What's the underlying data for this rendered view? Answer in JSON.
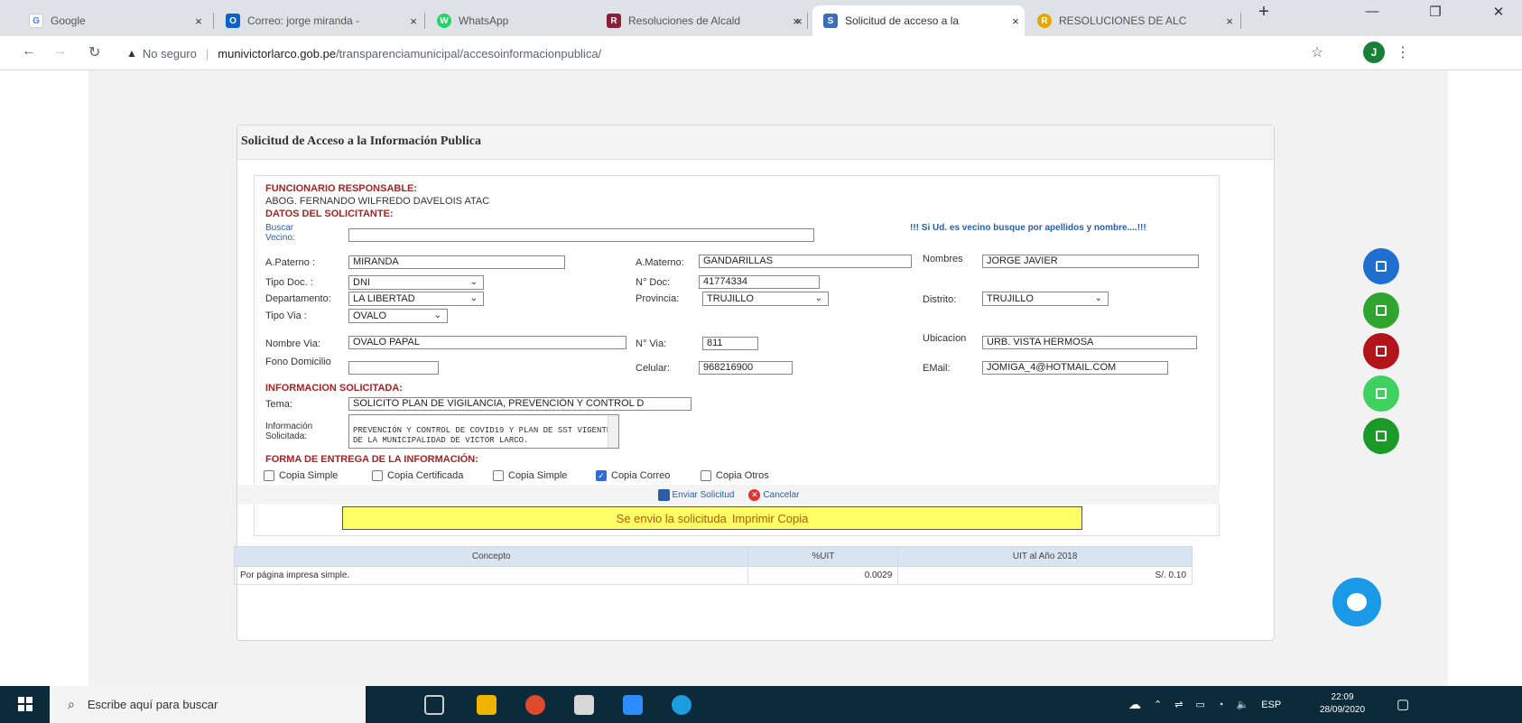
{
  "browser": {
    "tabs": [
      {
        "title": "Google",
        "icon": "G",
        "color": "#4285f4"
      },
      {
        "title": "Correo: jorge miranda -",
        "icon": "O",
        "color": "#0a64c8"
      },
      {
        "title": "WhatsApp",
        "icon": "W",
        "color": "#25d366"
      },
      {
        "title": "Resoluciones de Alcald",
        "icon": "R",
        "color": "#8a1f3c"
      },
      {
        "title": "Solicitud de acceso a la",
        "icon": "S",
        "color": "#3a6fb5"
      },
      {
        "title": "RESOLUCIONES DE ALC",
        "icon": "R",
        "color": "#e6a800"
      }
    ],
    "new_tab": "+",
    "tab_close": "×",
    "security": "No seguro",
    "url_domain": "munivictorlarco.gob.pe",
    "url_path": "/transparenciamunicipal/accesoinformacionpublica/",
    "profile_initial": "J"
  },
  "form": {
    "title": "Solicitud de Acceso a la Información Publica",
    "sec_funcionario": "FUNCIONARIO RESPONSABLE:",
    "funcionario": "ABOG. FERNANDO WILFREDO DAVELOIS ATAC",
    "sec_datos": "DATOS DEL SOLICITANTE:",
    "buscar_label": "Buscar Vecino:",
    "buscar_value": "",
    "vecino_hint": "!!! Si Ud. es vecino busque por apellidos y nombre....!!!",
    "apaterno_label": "A.Paterno :",
    "apaterno": "MIRANDA",
    "amaterno_label": "A.Materno:",
    "amaterno": "GANDARILLAS",
    "nombres_label": "Nombres",
    "nombres": "JORGE JAVIER",
    "tipodoc_label": "Tipo Doc. :",
    "tipodoc": "DNI",
    "ndoc_label": "N° Doc:",
    "ndoc": "41774334",
    "depto_label": "Departamento:",
    "depto": "LA LIBERTAD",
    "provincia_label": "Provincia:",
    "provincia": "TRUJILLO",
    "distrito_label": "Distrito:",
    "distrito": "TRUJILLO",
    "tipovia_label": "Tipo Via :",
    "tipovia": "OVALO",
    "nombrevia_label": "Nombre Via:",
    "nombrevia": "OVALO PAPAL",
    "nvia_label": "N° Via:",
    "nvia": "811",
    "ubicacion_label": "Ubicacion",
    "ubicacion": "URB. VISTA HERMOSA",
    "fono_label": "Fono Domicilio",
    "fono": "",
    "celular_label": "Celular:",
    "celular": "968216900",
    "email_label": "EMail:",
    "email": "JOMIGA_4@HOTMAIL.COM",
    "sec_info": "INFORMACION SOLICITADA:",
    "tema_label": "Tema:",
    "tema": "SOLICITO PLAN DE VIGILANCIA, PREVENCIÓN Y CONTROL D",
    "info_label": "Información Solicitada:",
    "info_text": "PREVENCIÓN Y CONTROL DE COVID19 Y PLAN DE SST VIGENTE DE LA MUNICIPALIDAD DE VICTOR LARCO.",
    "sec_forma": "FORMA DE ENTREGA DE LA INFORMACIÓN:",
    "options": [
      {
        "label": "Copia Simple",
        "checked": false
      },
      {
        "label": "Copia Certificada",
        "checked": false
      },
      {
        "label": "Copia Simple",
        "checked": false
      },
      {
        "label": "Copia Correo",
        "checked": true
      },
      {
        "label": "Copia Otros",
        "checked": false
      }
    ],
    "enviar": "Enviar Solicitud",
    "cancelar": "Cancelar",
    "notice": "Se envio la solicituda",
    "imprimir": "Imprimir Copia"
  },
  "table": {
    "headers": [
      "Concepto",
      "%UIT",
      "UIT al Año 2018"
    ],
    "row": [
      "Por página impresa simple.",
      "0.0029",
      "S/. 0.10"
    ]
  },
  "fab_colors": [
    "#1f6fd1",
    "#2ea52e",
    "#b3141c",
    "#3fd15f",
    "#1c9a28"
  ],
  "taskbar": {
    "search_placeholder": "Escribe aquí para buscar",
    "lang": "ESP",
    "time": "22:09",
    "date": "28/09/2020"
  }
}
